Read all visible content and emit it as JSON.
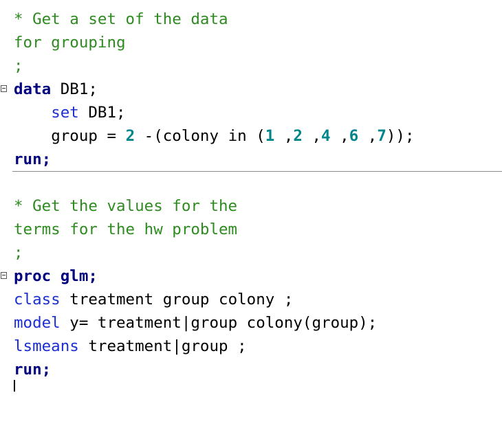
{
  "editor": {
    "block1": {
      "comment_line1": "* Get a set of the data",
      "comment_line2": "for grouping",
      "comment_end": ";",
      "data_kw": "data",
      "data_name": " DB1;",
      "set_indent": "    ",
      "set_kw": "set",
      "set_rest": " DB1;",
      "group_indent": "    ",
      "group_pre": "group = ",
      "group_num1": "2",
      "group_mid1": " -(colony in (",
      "group_n1": "1",
      "group_s1": " ,",
      "group_n2": "2",
      "group_s2": " ,",
      "group_n3": "4",
      "group_s3": " ,",
      "group_n4": "6",
      "group_s4": " ,",
      "group_n5": "7",
      "group_end": "));",
      "run": "run;"
    },
    "block2": {
      "comment_line1": "* Get the values for the",
      "comment_line2": "terms for the hw problem",
      "comment_end": ";",
      "proc_kw": "proc glm;",
      "class_kw": "class",
      "class_rest": " treatment group colony ;",
      "model_kw": "model",
      "model_rest": " y= treatment|group colony(group);",
      "lsmeans_kw": "lsmeans",
      "lsmeans_rest": " treatment|group ;",
      "run": "run;"
    }
  }
}
